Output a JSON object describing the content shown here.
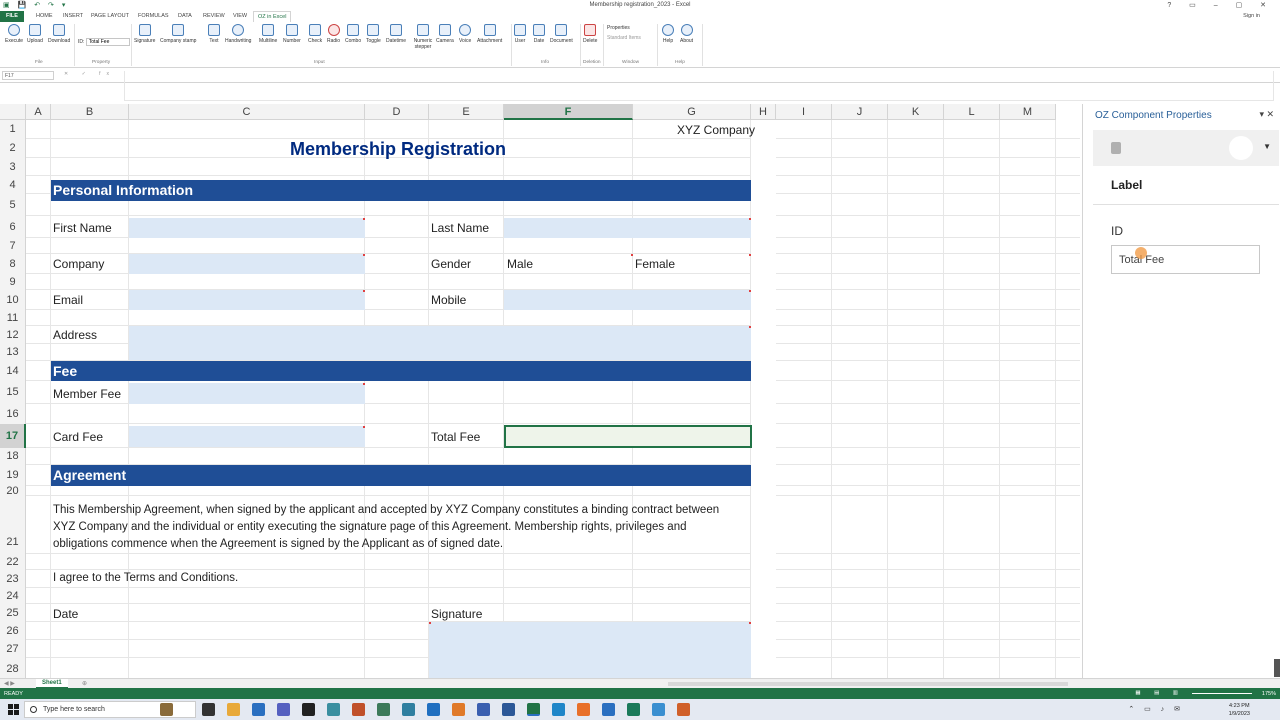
{
  "window": {
    "title": "Membership registration_2023 - Excel",
    "user": "Sign in"
  },
  "tabs": [
    {
      "label": "FILE",
      "kind": "file"
    },
    {
      "label": "HOME"
    },
    {
      "label": "INSERT"
    },
    {
      "label": "PAGE LAYOUT"
    },
    {
      "label": "FORMULAS"
    },
    {
      "label": "DATA"
    },
    {
      "label": "REVIEW"
    },
    {
      "label": "VIEW"
    },
    {
      "label": "OZ in Excel",
      "kind": "active"
    }
  ],
  "ribbon": {
    "buttons": [
      "Execute",
      "Upload",
      "Download",
      "Signature",
      "Company stamp",
      "Text",
      "Handwriting",
      "Multiline",
      "Number",
      "Check",
      "Radio",
      "Combo",
      "Toggle",
      "Datetime",
      "Numeric stepper",
      "Camera",
      "Voice",
      "Attachment",
      "User",
      "Date",
      "Document",
      "Delete",
      "Help",
      "About"
    ],
    "id_label": "ID:",
    "id_value": "Total Fee",
    "properties": "Properties",
    "standard_items": "Standard Items",
    "groups": [
      "File",
      "Property",
      "Input",
      "Info",
      "Deletion",
      "Window",
      "Help"
    ]
  },
  "formula_bar": {
    "name_box": "F17",
    "fx": "fx"
  },
  "sheet": {
    "columns": [
      "A",
      "B",
      "C",
      "D",
      "E",
      "F",
      "G",
      "H",
      "I",
      "J",
      "K",
      "L",
      "M"
    ],
    "selected_column": "F",
    "selected_row": "17",
    "rows": [
      "1",
      "2",
      "3",
      "4",
      "5",
      "6",
      "7",
      "8",
      "9",
      "10",
      "11",
      "12",
      "13",
      "14",
      "15",
      "16",
      "17",
      "18",
      "19",
      "20",
      "21",
      "22",
      "23",
      "24",
      "25",
      "26",
      "27",
      "28"
    ],
    "company": "XYZ Company",
    "title": "Membership Registration",
    "section_personal": "Personal Information",
    "section_fee": "Fee",
    "section_agreement": "Agreement",
    "first_name": "First Name",
    "last_name": "Last Name",
    "company_label": "Company",
    "gender": "Gender",
    "male": "Male",
    "female": "Female",
    "email": "Email",
    "mobile": "Mobile",
    "address": "Address",
    "member_fee": "Member Fee",
    "card_fee": "Card Fee",
    "total_fee": "Total Fee",
    "agreement_line1": "This Membership Agreement, when signed by the applicant and accepted by XYZ Company constitutes a binding contract between",
    "agreement_line2": "XYZ Company and the individual or entity executing the signature page of this Agreement. Membership rights, privileges and",
    "agreement_line3": "obligations commence when the Agreement is signed by the Applicant as of signed date.",
    "terms": "I agree to the Terms and Conditions.",
    "date": "Date",
    "signature": "Signature"
  },
  "panel": {
    "title": "OZ Component Properties",
    "section": "Label",
    "id_label": "ID",
    "id_value": "Total Fee"
  },
  "sheet_tabs": {
    "active": "Sheet1"
  },
  "status": {
    "ready": "READY",
    "zoom": "175%"
  },
  "taskbar": {
    "search_placeholder": "Type here to search",
    "time": "4:23 PM",
    "date": "1/9/2023"
  }
}
